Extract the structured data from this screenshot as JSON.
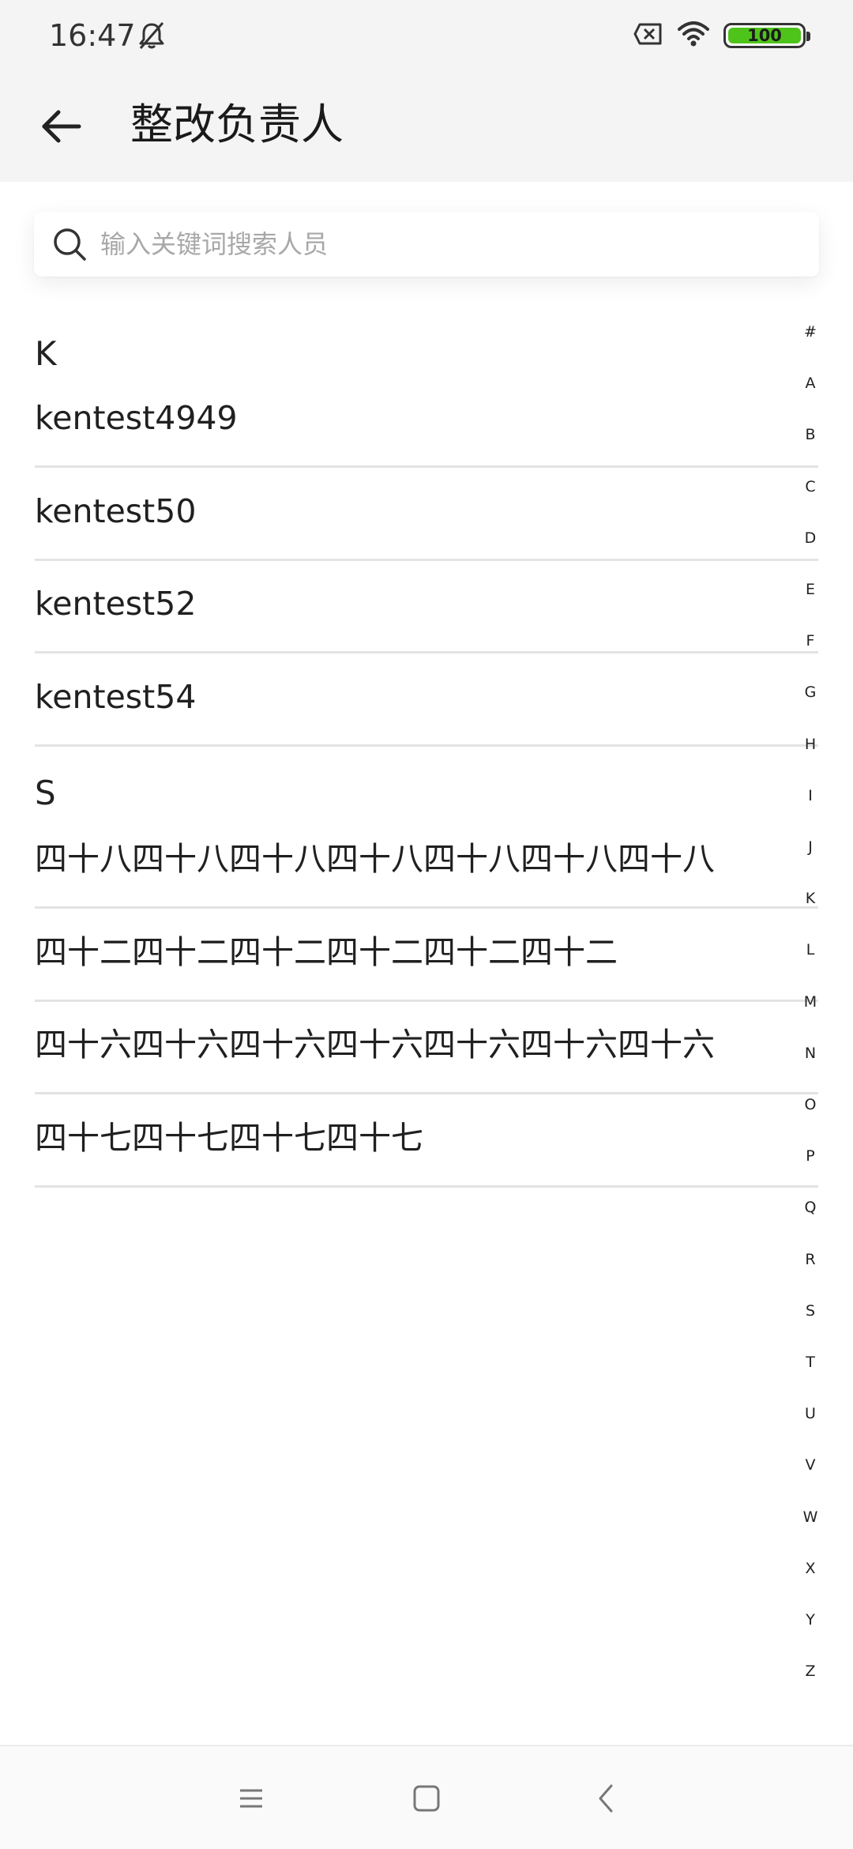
{
  "status_bar": {
    "time": "16:47",
    "battery": "100",
    "battery_level": 1.0,
    "icons": [
      "bell-off-icon",
      "sim-error-icon",
      "wifi-icon",
      "battery-icon"
    ]
  },
  "app_bar": {
    "back_icon": "arrow-left-icon",
    "title": "整改负责人"
  },
  "search": {
    "placeholder": "输入关键词搜索人员",
    "value": "",
    "icon": "search-icon"
  },
  "sections": [
    {
      "letter": "K",
      "items": [
        "kentest4949",
        "kentest50",
        "kentest52",
        "kentest54"
      ]
    },
    {
      "letter": "S",
      "items": [
        "四十八四十八四十八四十八四十八四十八四十八",
        "四十二四十二四十二四十二四十二四十二",
        "四十六四十六四十六四十六四十六四十六四十六",
        "四十七四十七四十七四十七"
      ]
    }
  ],
  "alpha_index": [
    "#",
    "A",
    "B",
    "C",
    "D",
    "E",
    "F",
    "G",
    "H",
    "I",
    "J",
    "K",
    "L",
    "M",
    "N",
    "O",
    "P",
    "Q",
    "R",
    "S",
    "T",
    "U",
    "V",
    "W",
    "X",
    "Y",
    "Z"
  ],
  "nav_bar": {
    "icons": [
      "menu-icon",
      "home-square-icon",
      "back-chevron-icon"
    ]
  },
  "colors": {
    "header_background": "#f4f4f4",
    "battery_green": "#4ec41a",
    "divider": "#e3e3e3",
    "placeholder_text": "#a8a8a8"
  }
}
